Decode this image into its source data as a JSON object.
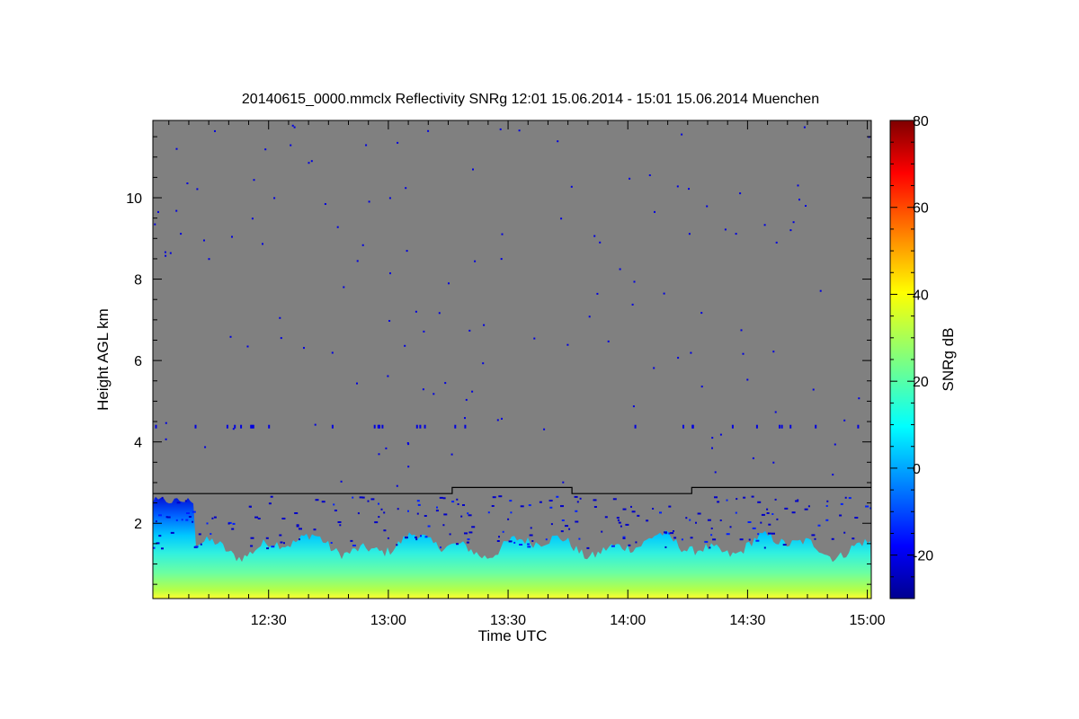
{
  "chart_data": {
    "type": "heatmap",
    "title": "20140615_0000.mmclx Reflectivity SNRg   12:01 15.06.2014 - 15:01 15.06.2014 Muenchen",
    "xlabel": "Time UTC",
    "ylabel": "Height AGL km",
    "colorbar_label": "SNRg dB",
    "x_range": [
      "12:01",
      "15:01"
    ],
    "y_range_km": [
      0.15,
      11.9
    ],
    "x_ticks": [
      "12:30",
      "13:00",
      "13:30",
      "14:00",
      "14:30",
      "15:00"
    ],
    "y_ticks": [
      "2",
      "4",
      "6",
      "8",
      "10"
    ],
    "colorbar_range": [
      -30,
      80
    ],
    "colorbar_ticks": [
      "-20",
      "0",
      "20",
      "40",
      "60",
      "80"
    ],
    "colormap": "jet",
    "background_color": "#808080",
    "boundary_line": [
      {
        "time": "12:01",
        "height_km": 2.73
      },
      {
        "time": "13:16",
        "height_km": 2.73
      },
      {
        "time": "13:16",
        "height_km": 2.88
      },
      {
        "time": "13:46",
        "height_km": 2.88
      },
      {
        "time": "13:46",
        "height_km": 2.73
      },
      {
        "time": "14:16",
        "height_km": 2.73
      },
      {
        "time": "14:16",
        "height_km": 2.88
      },
      {
        "time": "15:01",
        "height_km": 2.88
      }
    ]
  }
}
